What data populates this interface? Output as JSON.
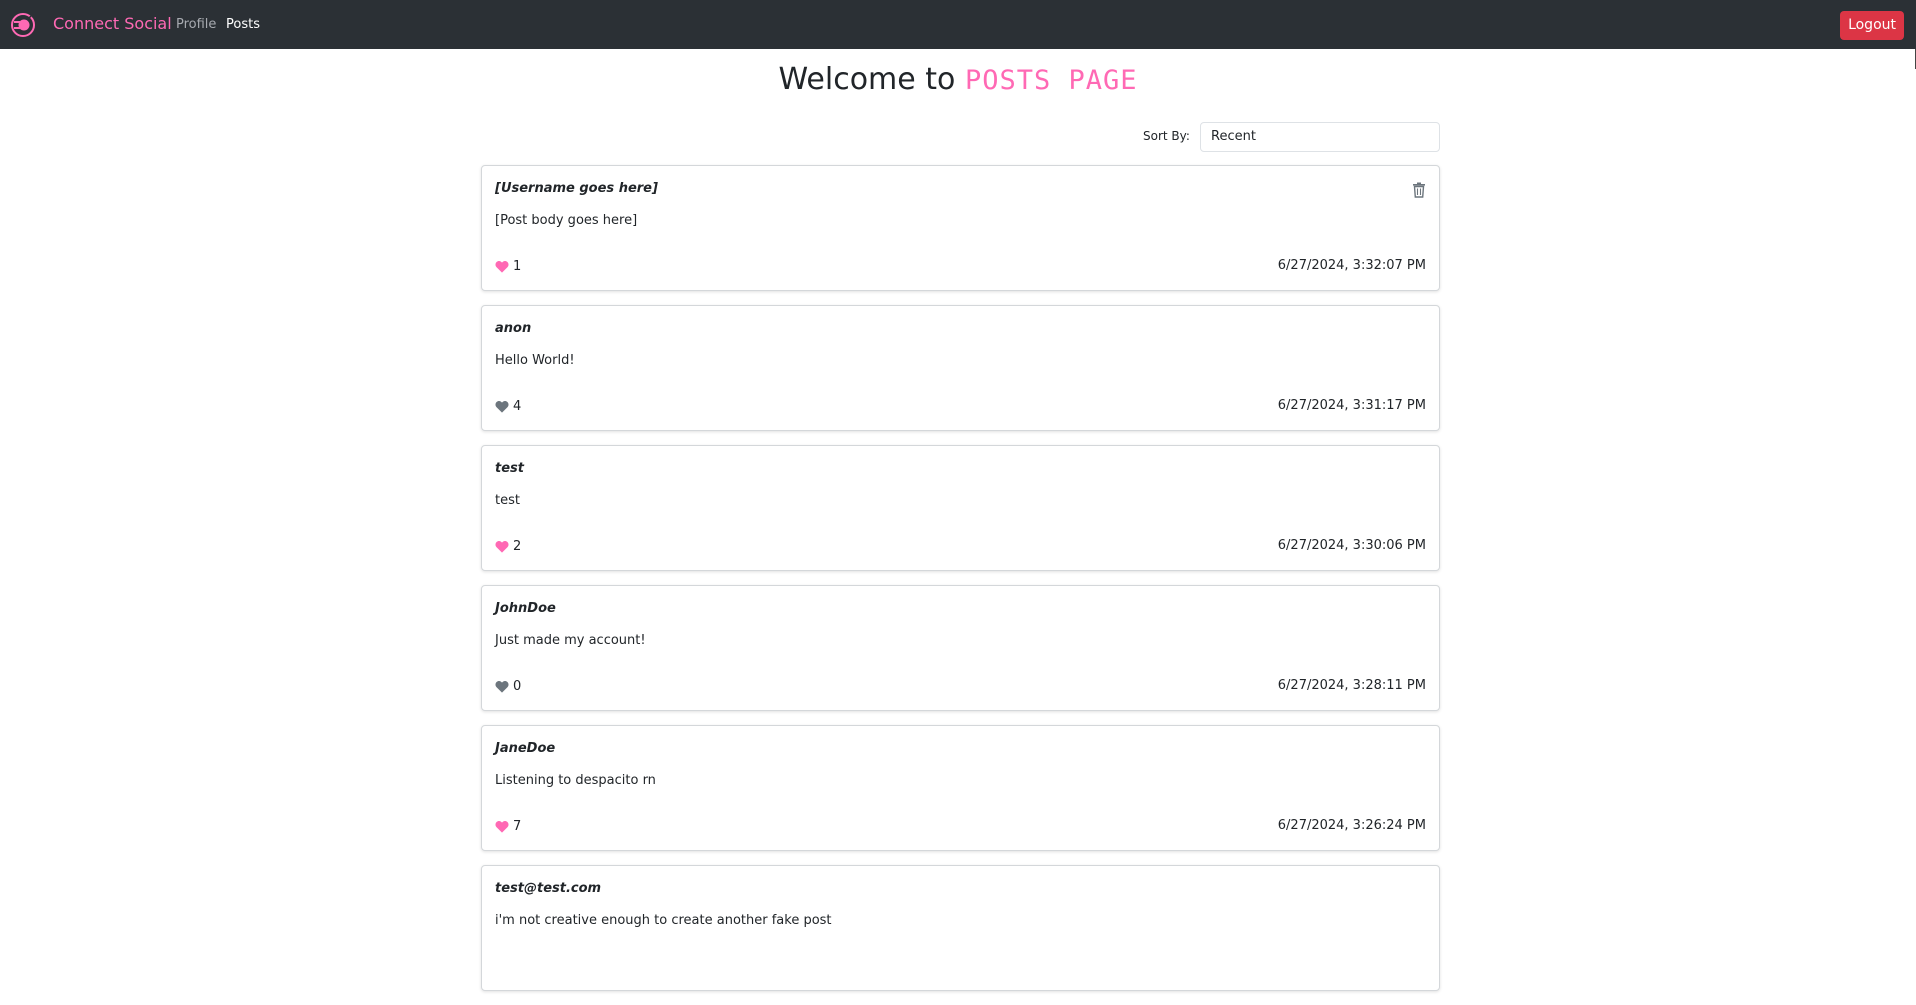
{
  "navbar": {
    "brand": "Connect Social",
    "links": [
      {
        "label": "Profile"
      },
      {
        "label": "Posts"
      }
    ],
    "logout_label": "Logout"
  },
  "heading": {
    "prefix": "Welcome to",
    "accent": "POSTS PAGE"
  },
  "sort": {
    "label": "Sort By:",
    "selected": "Recent"
  },
  "colors": {
    "accent": "#ff69b4",
    "liked": "#ff69b4",
    "unliked": "#6c757d",
    "danger": "#dc3545",
    "navbar": "#2b3035"
  },
  "posts": [
    {
      "username": "[Username goes here]",
      "body": "[Post body goes here]",
      "likes": "1",
      "liked": true,
      "timestamp": "6/27/2024, 3:32:07 PM",
      "deletable": true
    },
    {
      "username": "anon",
      "body": "Hello World!",
      "likes": "4",
      "liked": false,
      "timestamp": "6/27/2024, 3:31:17 PM",
      "deletable": false
    },
    {
      "username": "test",
      "body": "test",
      "likes": "2",
      "liked": true,
      "timestamp": "6/27/2024, 3:30:06 PM",
      "deletable": false
    },
    {
      "username": "JohnDoe",
      "body": "Just made my account!",
      "likes": "0",
      "liked": false,
      "timestamp": "6/27/2024, 3:28:11 PM",
      "deletable": false
    },
    {
      "username": "JaneDoe",
      "body": "Listening to despacito rn",
      "likes": "7",
      "liked": true,
      "timestamp": "6/27/2024, 3:26:24 PM",
      "deletable": false
    },
    {
      "username": "test@test.com",
      "body": "i'm not creative enough to create another fake post",
      "likes": "",
      "liked": false,
      "timestamp": "",
      "deletable": false
    }
  ]
}
